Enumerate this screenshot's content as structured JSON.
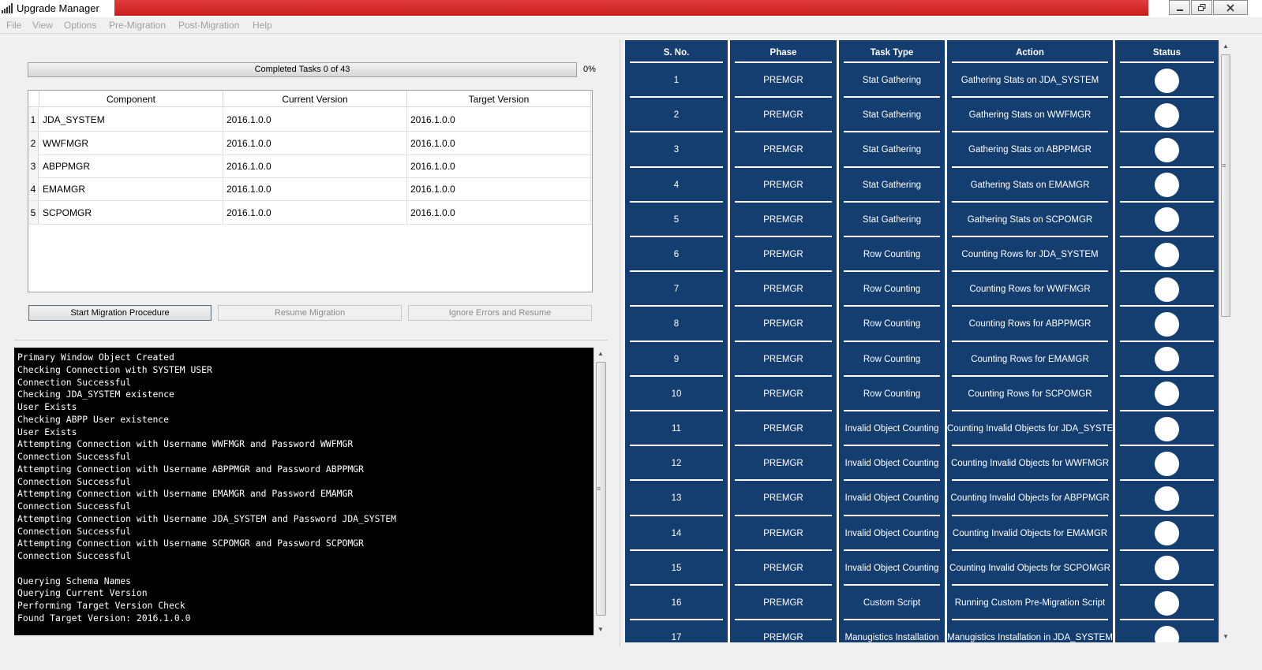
{
  "window": {
    "title": "Upgrade Manager",
    "minimize_icon": "minimize-icon",
    "maximize_icon": "restore-icon",
    "close_icon": "close-icon"
  },
  "menu": [
    "File",
    "View",
    "Options",
    "Pre-Migration",
    "Post-Migration",
    "Help"
  ],
  "progress": {
    "label": "Completed Tasks 0 of 43",
    "percent_text": "0%",
    "fraction": 0
  },
  "components": {
    "headers": [
      "Component",
      "Current Version",
      "Target Version"
    ],
    "rows": [
      {
        "n": "1",
        "component": "JDA_SYSTEM",
        "current": "2016.1.0.0",
        "target": "2016.1.0.0"
      },
      {
        "n": "2",
        "component": "WWFMGR",
        "current": "2016.1.0.0",
        "target": "2016.1.0.0"
      },
      {
        "n": "3",
        "component": "ABPPMGR",
        "current": "2016.1.0.0",
        "target": "2016.1.0.0"
      },
      {
        "n": "4",
        "component": "EMAMGR",
        "current": "2016.1.0.0",
        "target": "2016.1.0.0"
      },
      {
        "n": "5",
        "component": "SCPOMGR",
        "current": "2016.1.0.0",
        "target": "2016.1.0.0"
      }
    ]
  },
  "buttons": {
    "start": "Start Migration Procedure",
    "resume": "Resume Migration",
    "ignore": "Ignore Errors and Resume"
  },
  "console": [
    "Primary Window Object Created",
    "Checking Connection with SYSTEM USER",
    "Connection Successful",
    "Checking JDA_SYSTEM existence",
    "User Exists",
    "Checking ABPP User existence",
    "User Exists",
    "Attempting Connection with Username WWFMGR and Password WWFMGR",
    "Connection Successful",
    "Attempting Connection with Username ABPPMGR and Password ABPPMGR",
    "Connection Successful",
    "Attempting Connection with Username EMAMGR and Password EMAMGR",
    "Connection Successful",
    "Attempting Connection with Username JDA_SYSTEM and Password JDA_SYSTEM",
    "Connection Successful",
    "Attempting Connection with Username SCPOMGR and Password SCPOMGR",
    "Connection Successful",
    "",
    "Querying Schema Names",
    "Querying Current Version",
    "Performing Target Version Check",
    "Found Target Version: 2016.1.0.0"
  ],
  "tasks": {
    "headers": [
      "S. No.",
      "Phase",
      "Task Type",
      "Action",
      "Status"
    ],
    "status_color": "#ffffff",
    "panel_color": "#153e70",
    "rows": [
      {
        "sno": "1",
        "phase": "PREMGR",
        "type": "Stat Gathering",
        "action": "Gathering Stats on JDA_SYSTEM"
      },
      {
        "sno": "2",
        "phase": "PREMGR",
        "type": "Stat Gathering",
        "action": "Gathering Stats on WWFMGR"
      },
      {
        "sno": "3",
        "phase": "PREMGR",
        "type": "Stat Gathering",
        "action": "Gathering Stats on ABPPMGR"
      },
      {
        "sno": "4",
        "phase": "PREMGR",
        "type": "Stat Gathering",
        "action": "Gathering Stats on EMAMGR"
      },
      {
        "sno": "5",
        "phase": "PREMGR",
        "type": "Stat Gathering",
        "action": "Gathering Stats on SCPOMGR"
      },
      {
        "sno": "6",
        "phase": "PREMGR",
        "type": "Row Counting",
        "action": "Counting Rows for JDA_SYSTEM"
      },
      {
        "sno": "7",
        "phase": "PREMGR",
        "type": "Row Counting",
        "action": "Counting Rows for WWFMGR"
      },
      {
        "sno": "8",
        "phase": "PREMGR",
        "type": "Row Counting",
        "action": "Counting Rows for ABPPMGR"
      },
      {
        "sno": "9",
        "phase": "PREMGR",
        "type": "Row Counting",
        "action": "Counting Rows for EMAMGR"
      },
      {
        "sno": "10",
        "phase": "PREMGR",
        "type": "Row Counting",
        "action": "Counting Rows for SCPOMGR"
      },
      {
        "sno": "11",
        "phase": "PREMGR",
        "type": "Invalid Object Counting",
        "action": "Counting Invalid Objects for JDA_SYSTEM"
      },
      {
        "sno": "12",
        "phase": "PREMGR",
        "type": "Invalid Object Counting",
        "action": "Counting Invalid Objects for WWFMGR"
      },
      {
        "sno": "13",
        "phase": "PREMGR",
        "type": "Invalid Object Counting",
        "action": "Counting Invalid Objects for ABPPMGR"
      },
      {
        "sno": "14",
        "phase": "PREMGR",
        "type": "Invalid Object Counting",
        "action": "Counting Invalid Objects for EMAMGR"
      },
      {
        "sno": "15",
        "phase": "PREMGR",
        "type": "Invalid Object Counting",
        "action": "Counting Invalid Objects for SCPOMGR"
      },
      {
        "sno": "16",
        "phase": "PREMGR",
        "type": "Custom Script",
        "action": "Running Custom Pre-Migration Script"
      },
      {
        "sno": "17",
        "phase": "PREMGR",
        "type": "Manugistics Installation",
        "action": "Manugistics Installation in JDA_SYSTEM"
      }
    ]
  }
}
